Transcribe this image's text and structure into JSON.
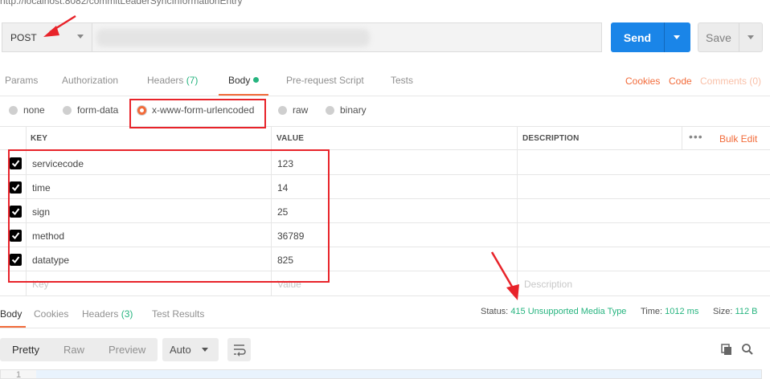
{
  "request": {
    "url_partial": "http://localhost:8082/commitLeaderSyncInformationEntry",
    "method": "POST",
    "send_label": "Send",
    "save_label": "Save"
  },
  "tabs": {
    "params": "Params",
    "authorization": "Authorization",
    "headers": "Headers",
    "headers_count": "(7)",
    "body": "Body",
    "prerequest": "Pre-request Script",
    "tests": "Tests"
  },
  "right_links": {
    "cookies": "Cookies",
    "code": "Code",
    "comments": "Comments (0)"
  },
  "body_types": {
    "none": "none",
    "form_data": "form-data",
    "urlencoded": "x-www-form-urlencoded",
    "raw": "raw",
    "binary": "binary",
    "selected": "x-www-form-urlencoded"
  },
  "table": {
    "headers": {
      "key": "KEY",
      "value": "VALUE",
      "description": "DESCRIPTION"
    },
    "more": "•••",
    "bulk_edit": "Bulk Edit",
    "rows": [
      {
        "key": "servicecode",
        "value": "123",
        "checked": true
      },
      {
        "key": "time",
        "value": "14",
        "checked": true
      },
      {
        "key": "sign",
        "value": "25",
        "checked": true
      },
      {
        "key": "method",
        "value": "36789",
        "checked": true
      },
      {
        "key": "datatype",
        "value": "825",
        "checked": true
      }
    ],
    "placeholders": {
      "key": "Key",
      "value": "Value",
      "description": "Description"
    }
  },
  "response": {
    "tabs": {
      "body": "Body",
      "cookies": "Cookies",
      "headers": "Headers",
      "headers_count": "(3)",
      "test_results": "Test Results"
    },
    "status_label": "Status:",
    "status_value": "415 Unsupported Media Type",
    "time_label": "Time:",
    "time_value": "1012 ms",
    "size_label": "Size:",
    "size_value": "112 B",
    "formats": {
      "pretty": "Pretty",
      "raw": "Raw",
      "preview": "Preview"
    },
    "language": "Auto",
    "line_number": "1"
  },
  "colors": {
    "accent": "#f26b3a",
    "send": "#1a85e8",
    "success": "#26b47f",
    "annotation": "#e8232a"
  }
}
